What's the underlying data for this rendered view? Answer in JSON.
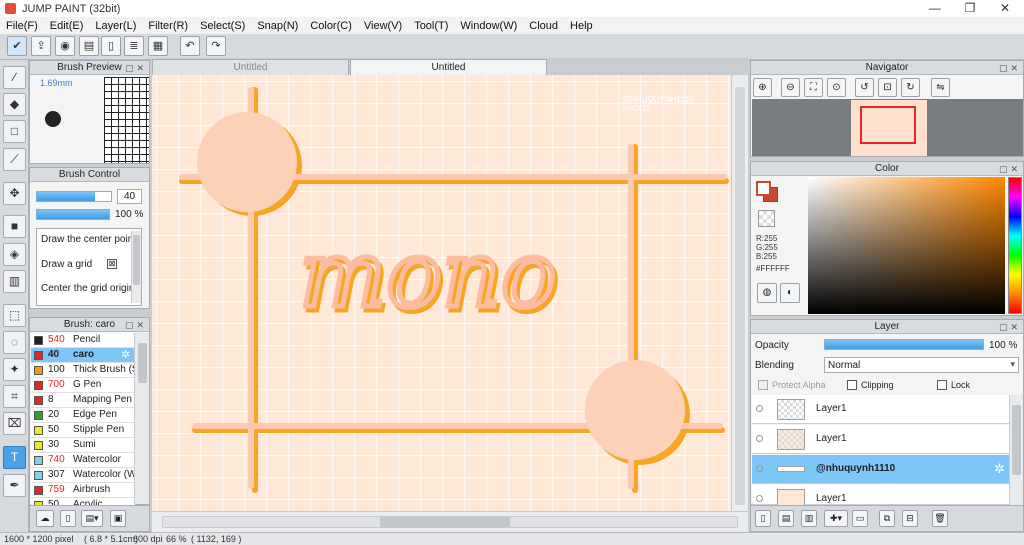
{
  "window": {
    "title": "JUMP PAINT (32bit)",
    "minimize": "—",
    "maximize": "❐",
    "close": "✕"
  },
  "menu": [
    "File(F)",
    "Edit(E)",
    "Layer(L)",
    "Filter(R)",
    "Select(S)",
    "Snap(N)",
    "Color(C)",
    "View(V)",
    "Tool(T)",
    "Window(W)",
    "Cloud",
    "Help"
  ],
  "toolbar": {
    "icons": [
      "check-icon",
      "upload-icon",
      "speech-bubble-icon",
      "comment-icon",
      "document-icon",
      "document-list-icon",
      "layout-icon",
      "undo-icon",
      "redo-icon"
    ]
  },
  "brush_preview": {
    "title": "Brush Preview",
    "size": "1.69mm"
  },
  "brush_control": {
    "title": "Brush Control",
    "size_value": "40",
    "size_fill": 0.78,
    "opacity_value": "100 %",
    "opacity_fill": 1.0,
    "options": [
      "Draw the center point",
      "Draw a grid",
      "Center the grid origin"
    ]
  },
  "brush_list": {
    "title": "Brush: caro",
    "items": [
      {
        "size": "540",
        "name": "Pencil",
        "color": "#222222",
        "size_red": true
      },
      {
        "size": "40",
        "name": "caro",
        "color": "#e52626",
        "size_red": false,
        "selected": true
      },
      {
        "size": "100",
        "name": "Thick Brush (Soft)",
        "color": "#f29a1a",
        "size_red": false
      },
      {
        "size": "700",
        "name": "G Pen",
        "color": "#e52626",
        "size_red": true
      },
      {
        "size": "8",
        "name": "Mapping Pen",
        "color": "#e52626",
        "size_red": false
      },
      {
        "size": "20",
        "name": "Edge Pen",
        "color": "#2aa52a",
        "size_red": false
      },
      {
        "size": "50",
        "name": "Stipple Pen",
        "color": "#e8e82a",
        "size_red": false
      },
      {
        "size": "30",
        "name": "Sumi",
        "color": "#e8e82a",
        "size_red": false
      },
      {
        "size": "740",
        "name": "Watercolor",
        "color": "#7dd0f0",
        "size_red": true
      },
      {
        "size": "307",
        "name": "Watercolor (Wet)",
        "color": "#7dd0f0",
        "size_red": false
      },
      {
        "size": "759",
        "name": "Airbrush",
        "color": "#e52626",
        "size_red": true
      },
      {
        "size": "50",
        "name": "Acrylic",
        "color": "#e8e82a",
        "size_red": false
      }
    ]
  },
  "canvas": {
    "tabs": [
      {
        "label": "Untitled",
        "active": false
      },
      {
        "label": "Untitled",
        "active": true
      }
    ],
    "artwork_text": "mono",
    "watermark": [
      "@NHUQUYNH1110",
      "SHOOT"
    ],
    "colors": {
      "background": "#ffe8d8",
      "circle": "#fdd0b8",
      "line": "#fcc8b0",
      "shadow": "#f6a623"
    }
  },
  "navigator": {
    "title": "Navigator"
  },
  "color_panel": {
    "title": "Color",
    "r": "R:255",
    "g": "G:255",
    "b": "B:255",
    "hex": "#FFFFFF",
    "fg": "#ffffff",
    "bg": "#c8492e"
  },
  "layer_panel": {
    "title": "Layer",
    "opacity_label": "Opacity",
    "opacity_value": "100 %",
    "opacity_fill": 1.0,
    "blending_label": "Blending",
    "blending_value": "Normal",
    "protect_alpha": "Protect Alpha",
    "clipping": "Clipping",
    "lock": "Lock",
    "layers": [
      {
        "name": "Layer1",
        "selected": false
      },
      {
        "name": "Layer1",
        "selected": false
      },
      {
        "name": "@nhuquynh1110",
        "selected": true
      },
      {
        "name": "Layer1",
        "selected": false
      }
    ]
  },
  "status": {
    "size": "1600 * 1200 pixel",
    "print": "( 6.8 * 5.1cm)",
    "dpi": "600 dpi",
    "zoom": "66 %",
    "coords": "( 1132, 169 )"
  }
}
